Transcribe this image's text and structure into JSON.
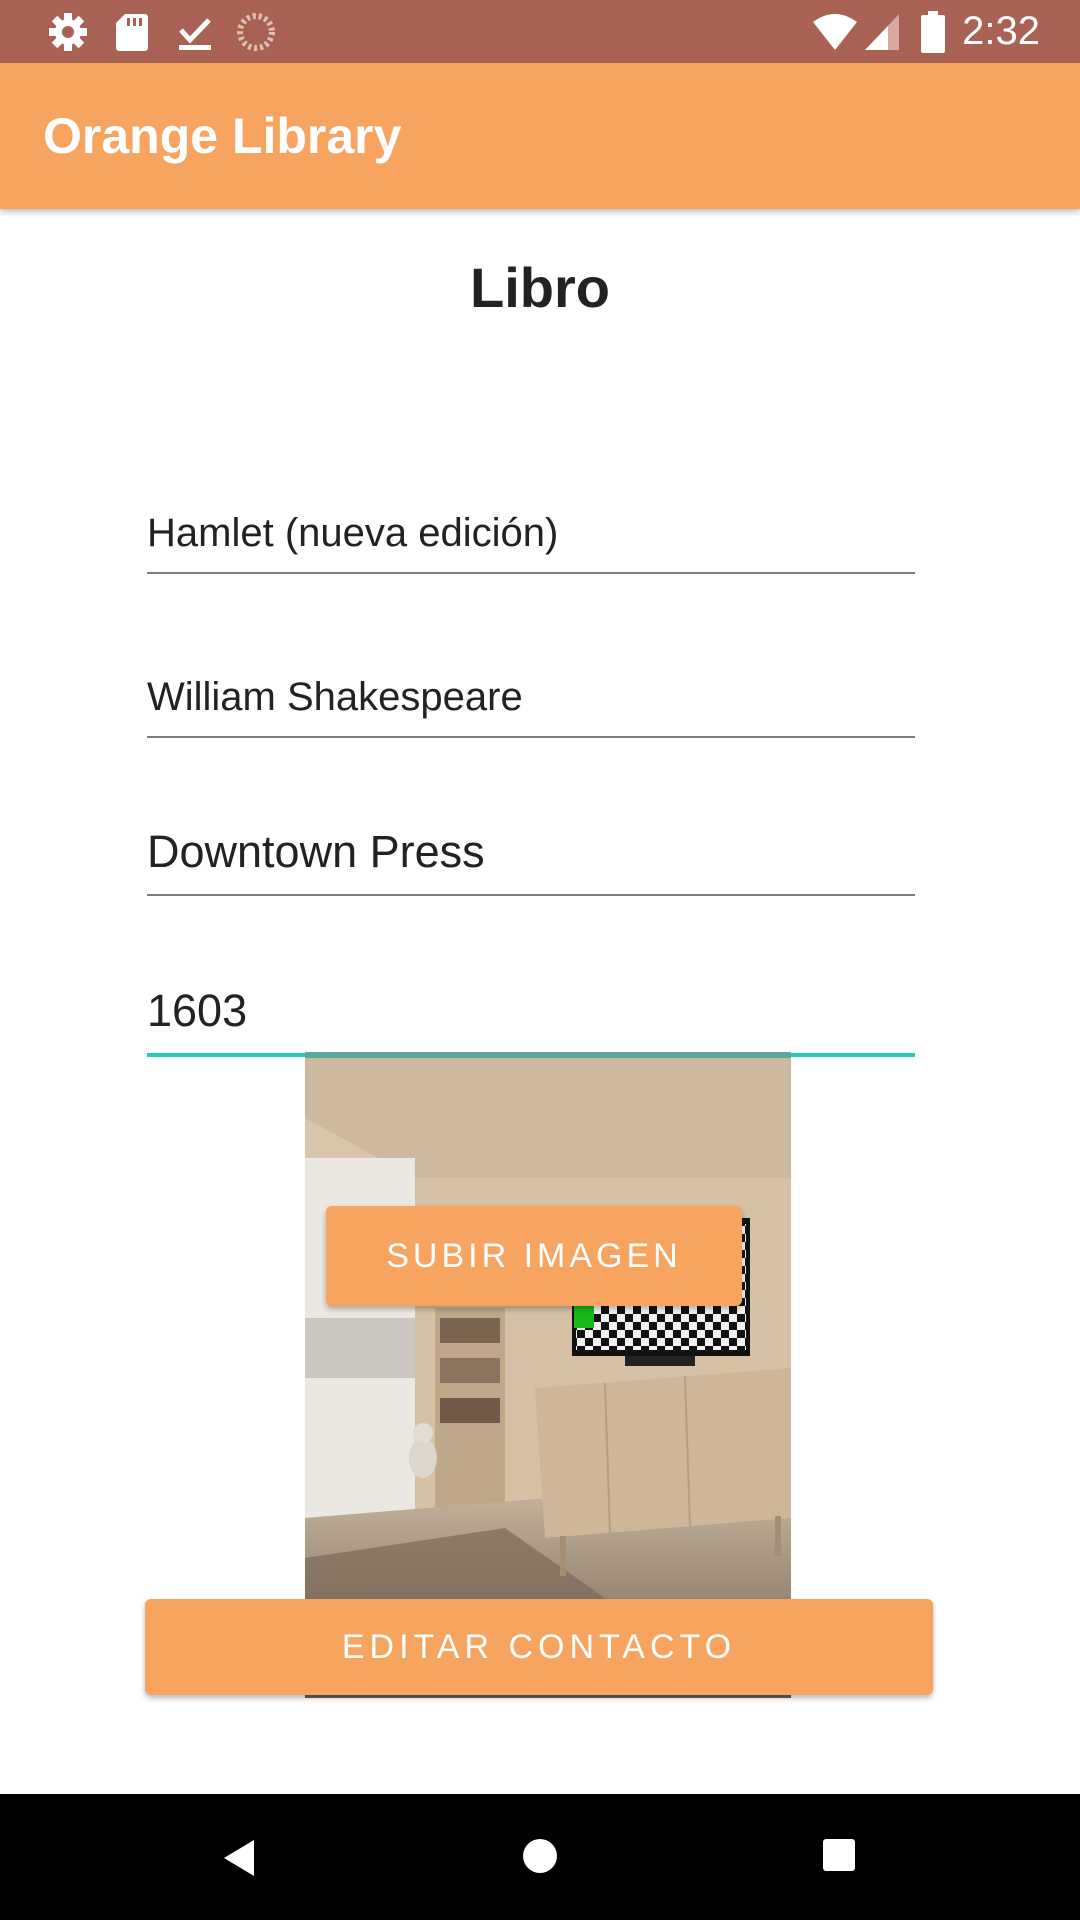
{
  "status_bar": {
    "time": "2:32",
    "icons": [
      "settings-icon",
      "sd-card-icon",
      "download-done-icon",
      "loading-icon",
      "wifi-icon",
      "signal-icon",
      "battery-icon"
    ]
  },
  "app_bar": {
    "title": "Orange Library"
  },
  "page": {
    "heading": "Libro"
  },
  "form": {
    "title_value": "Hamlet (nueva edición)",
    "author_value": "William Shakespeare",
    "publisher_value": "Downtown Press",
    "year_value": "1603"
  },
  "buttons": {
    "upload_label": "SUBIR IMAGEN",
    "edit_label": "EDITAR CONTACTO"
  },
  "colors": {
    "status_bar": "#a86153",
    "accent_orange": "#f6a460",
    "focused_field_underline": "#1fcfb9"
  },
  "nav_bar": {
    "icons": [
      "back-icon",
      "home-icon",
      "recents-icon"
    ]
  }
}
